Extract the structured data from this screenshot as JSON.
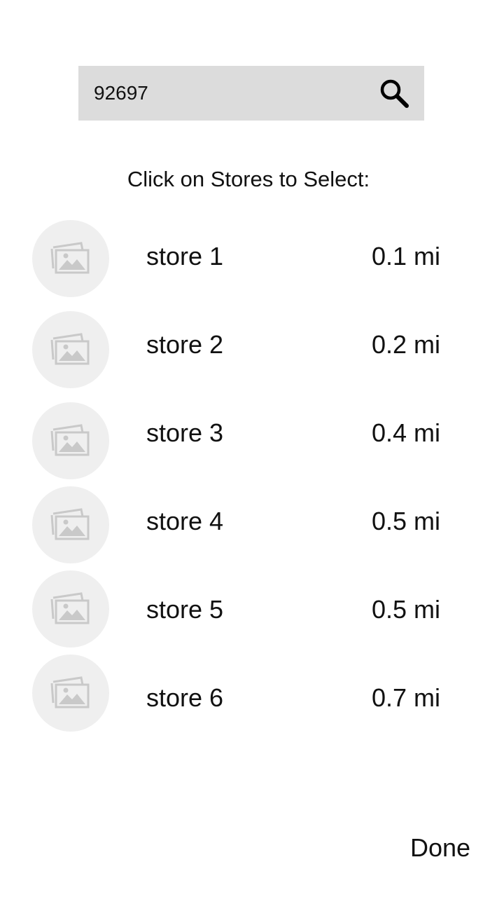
{
  "search": {
    "value": "92697",
    "icon": "search-icon"
  },
  "instruction": "Click on Stores to Select:",
  "stores": [
    {
      "name": "store 1",
      "distance": "0.1 mi",
      "icon": "image-placeholder-icon"
    },
    {
      "name": "store 2",
      "distance": "0.2 mi",
      "icon": "image-placeholder-icon"
    },
    {
      "name": "store 3",
      "distance": "0.4 mi",
      "icon": "image-placeholder-icon"
    },
    {
      "name": "store 4",
      "distance": "0.5 mi",
      "icon": "image-placeholder-icon"
    },
    {
      "name": "store 5",
      "distance": "0.5 mi",
      "icon": "image-placeholder-icon"
    },
    {
      "name": "store 6",
      "distance": "0.7 mi",
      "icon": "image-placeholder-icon"
    }
  ],
  "done_label": "Done",
  "colors": {
    "search_background": "#dcdcdc",
    "thumbnail_background": "#efefef",
    "placeholder_icon": "#c9c9c9",
    "text": "#111111"
  }
}
